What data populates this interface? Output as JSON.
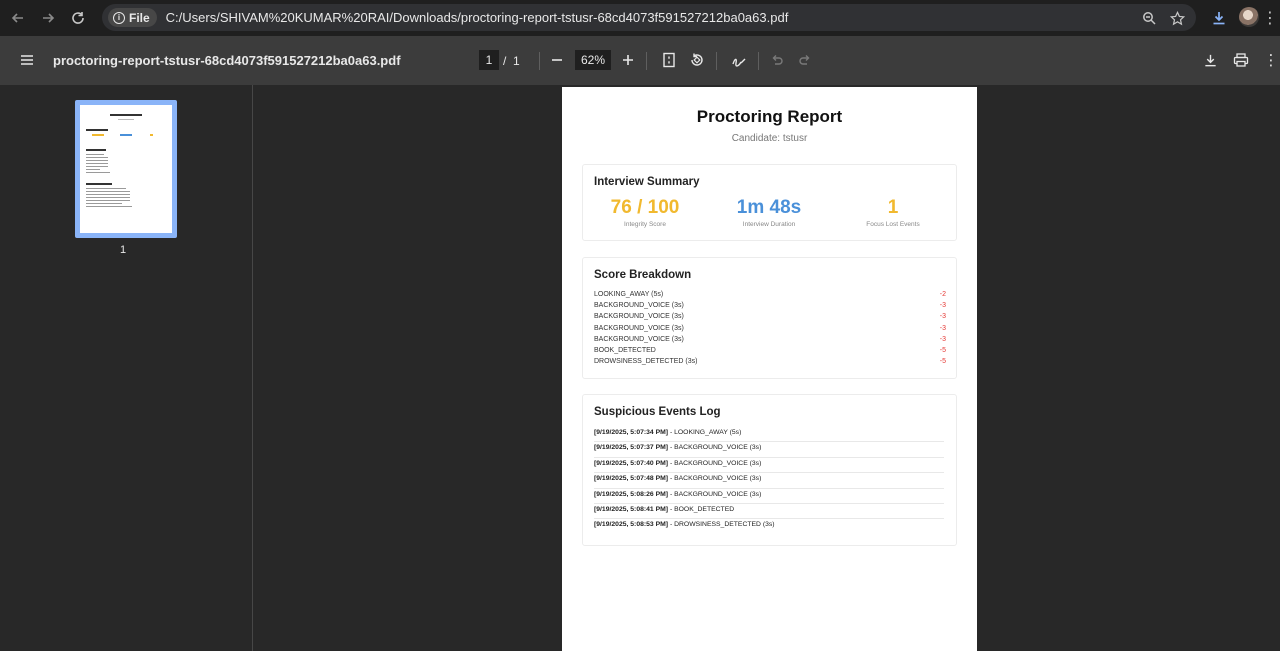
{
  "browser": {
    "file_chip": "File",
    "url": "C:/Users/SHIVAM%20KUMAR%20RAI/Downloads/proctoring-report-tstusr-68cd4073f591527212ba0a63.pdf"
  },
  "toolbar": {
    "title": "proctoring-report-tstusr-68cd4073f591527212ba0a63.pdf",
    "page_current": "1",
    "page_separator": "/",
    "page_total": "1",
    "zoom": "62%"
  },
  "sidebar": {
    "thumbnail_page_number": "1"
  },
  "report": {
    "title": "Proctoring Report",
    "candidate": "Candidate: tstusr",
    "summary": {
      "heading": "Interview Summary",
      "stats": [
        {
          "value": "76 / 100",
          "label": "Integrity Score",
          "color": "#f1b92f"
        },
        {
          "value": "1m 48s",
          "label": "Interview Duration",
          "color": "#4a90d9"
        },
        {
          "value": "1",
          "label": "Focus Lost Events",
          "color": "#f1b92f"
        }
      ]
    },
    "breakdown": {
      "heading": "Score Breakdown",
      "rows": [
        {
          "label": "LOOKING_AWAY (5s)",
          "penalty": "-2"
        },
        {
          "label": "BACKGROUND_VOICE (3s)",
          "penalty": "-3"
        },
        {
          "label": "BACKGROUND_VOICE (3s)",
          "penalty": "-3"
        },
        {
          "label": "BACKGROUND_VOICE (3s)",
          "penalty": "-3"
        },
        {
          "label": "BACKGROUND_VOICE (3s)",
          "penalty": "-3"
        },
        {
          "label": "BOOK_DETECTED",
          "penalty": "-5"
        },
        {
          "label": "DROWSINESS_DETECTED (3s)",
          "penalty": "-5"
        }
      ]
    },
    "events": {
      "heading": "Suspicious Events Log",
      "rows": [
        {
          "time": "[9/19/2025, 5:07:34 PM]",
          "event": " - LOOKING_AWAY (5s)"
        },
        {
          "time": "[9/19/2025, 5:07:37 PM]",
          "event": " - BACKGROUND_VOICE (3s)"
        },
        {
          "time": "[9/19/2025, 5:07:40 PM]",
          "event": " - BACKGROUND_VOICE (3s)"
        },
        {
          "time": "[9/19/2025, 5:07:48 PM]",
          "event": " - BACKGROUND_VOICE (3s)"
        },
        {
          "time": "[9/19/2025, 5:08:26 PM]",
          "event": " - BACKGROUND_VOICE (3s)"
        },
        {
          "time": "[9/19/2025, 5:08:41 PM]",
          "event": " - BOOK_DETECTED"
        },
        {
          "time": "[9/19/2025, 5:08:53 PM]",
          "event": " - DROWSINESS_DETECTED (3s)"
        }
      ]
    }
  }
}
